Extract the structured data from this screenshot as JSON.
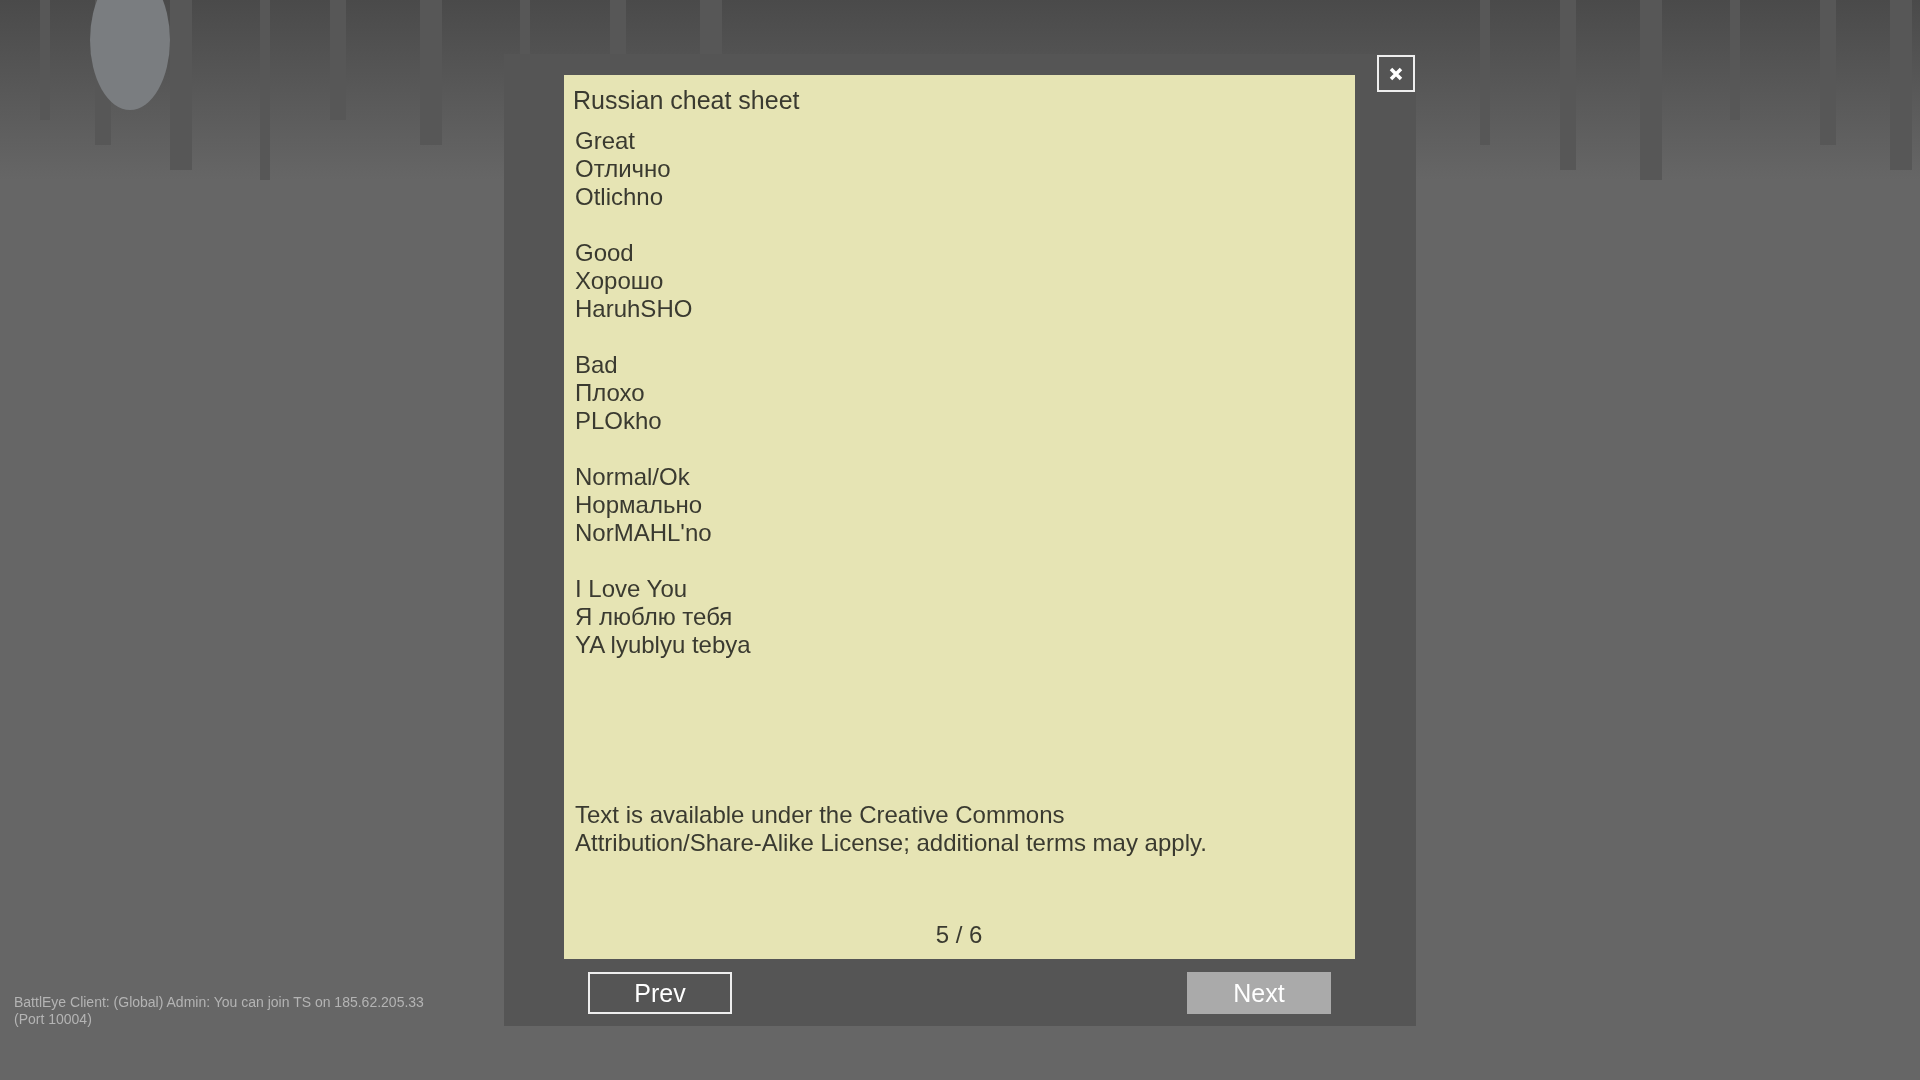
{
  "dialog": {
    "title": "Russian cheat sheet",
    "entries": [
      {
        "english": "Great",
        "russian": "Отлично",
        "transliteration": "Otlichno"
      },
      {
        "english": "Good",
        "russian": "Хорошо",
        "transliteration": "HaruhSHO"
      },
      {
        "english": "Bad",
        "russian": "Плохо",
        "transliteration": "PLOkho"
      },
      {
        "english": "Normal/Ok",
        "russian": "Нормально",
        "transliteration": "NorMAHL'no"
      },
      {
        "english": "I Love You",
        "russian": "Я люблю тебя",
        "transliteration": "YA lyublyu tebya"
      }
    ],
    "license_lines": [
      "Text is available under the Creative Commons",
      "Attribution/Share-Alike License; additional terms may apply."
    ],
    "page_indicator": "5 / 6",
    "buttons": [
      {
        "label": "Prev",
        "highlighted": false
      },
      {
        "label": "Next",
        "highlighted": true
      }
    ]
  },
  "chat_message": "BattlEye Client: (Global) Admin: You can join TS on 185.62.205.33 (Port 10004)"
}
